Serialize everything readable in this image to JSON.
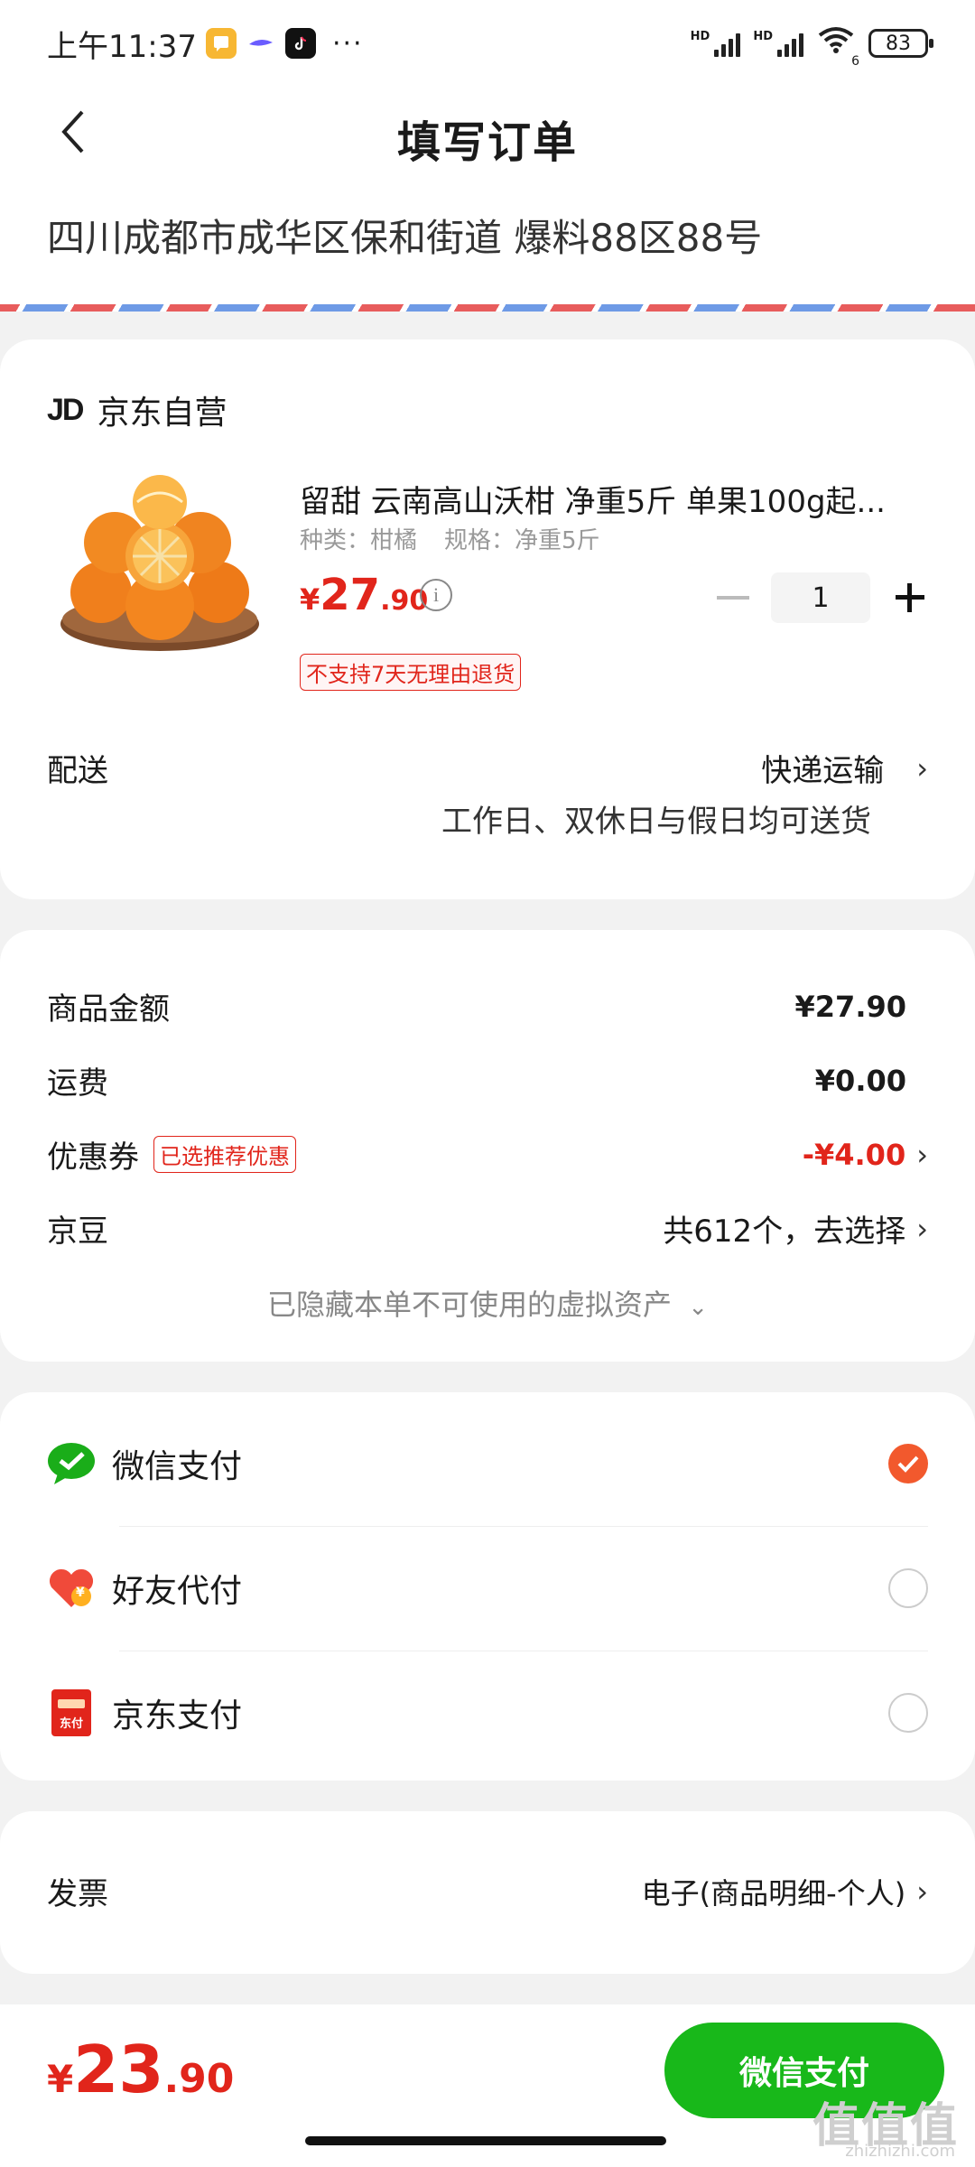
{
  "status_bar": {
    "time": "上午11:37",
    "more": "···",
    "battery": "83",
    "hd1": "HD",
    "hd2": "HD",
    "wifi_num": "6"
  },
  "header": {
    "title": "填写订单"
  },
  "address": {
    "text": "四川成都市成华区保和街道 爆料88区88号"
  },
  "shop": {
    "logo": "JD",
    "name": "京东自营"
  },
  "product": {
    "name": "留甜 云南高山沃柑 净重5斤 单果100g起...",
    "spec_kind": "种类：柑橘",
    "spec_size": "规格：净重5斤",
    "price_currency": "¥",
    "price_int": "27",
    "price_dec": ".90",
    "quantity": "1",
    "tag": "不支持7天无理由退货"
  },
  "delivery": {
    "label": "配送",
    "method": "快递运输",
    "note": "工作日、双休日与假日均可送货"
  },
  "summary": {
    "goods_label": "商品金额",
    "goods_value": "¥27.90",
    "freight_label": "运费",
    "freight_value": "¥0.00",
    "coupon_label": "优惠券",
    "coupon_badge": "已选推荐优惠",
    "coupon_value": "-¥4.00",
    "beans_label": "京豆",
    "beans_value": "共612个，去选择",
    "hidden_note": "已隐藏本单不可使用的虚拟资产"
  },
  "payment": {
    "options": [
      {
        "label": "微信支付",
        "selected": true
      },
      {
        "label": "好友代付",
        "selected": false
      },
      {
        "label": "京东支付",
        "selected": false
      }
    ],
    "jd_icon_text": "东付",
    "friend_icon_text": "¥"
  },
  "invoice": {
    "label": "发票",
    "value": "电子(商品明细-个人)"
  },
  "footer": {
    "currency": "¥",
    "total_int": "23",
    "total_dec": ".90",
    "pay_button": "微信支付"
  },
  "watermark": {
    "main": "值值值",
    "sub": "zhizhizhi.com"
  },
  "colors": {
    "accent_red": "#e1251b",
    "wechat_green": "#18b81a",
    "radio_orange": "#f2592d"
  }
}
